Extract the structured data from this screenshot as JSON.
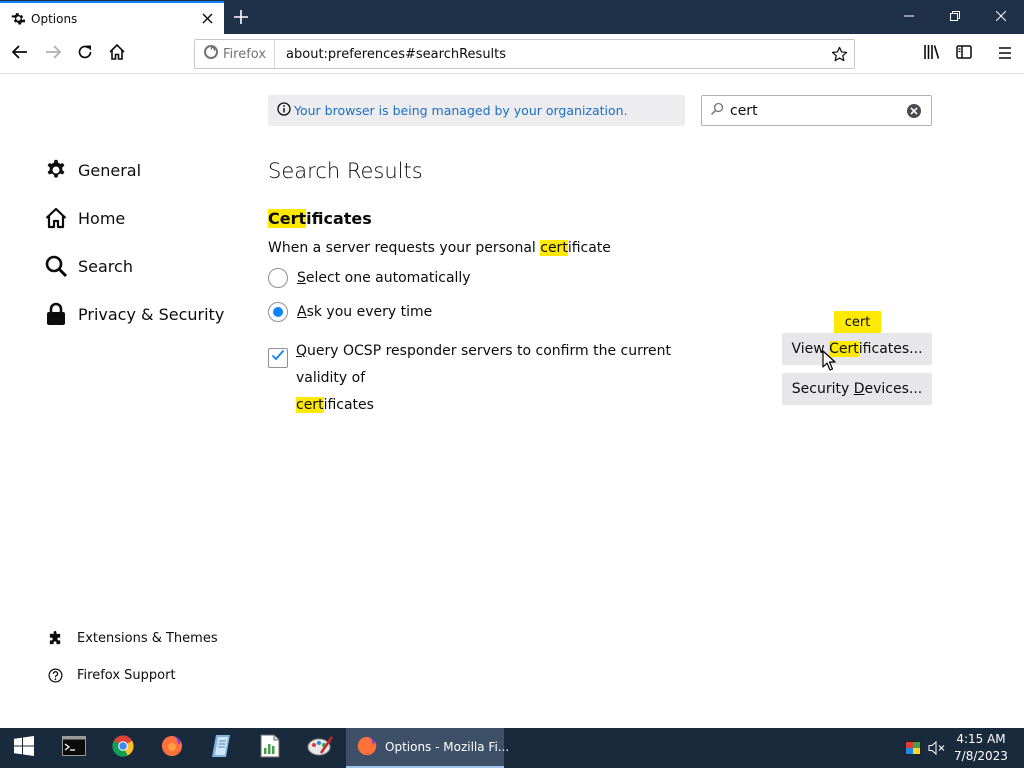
{
  "tab": {
    "title": "Options"
  },
  "nav": {
    "identity_label": "Firefox",
    "url": "about:preferences#searchResults"
  },
  "managed_notice": "Your browser is being managed by your organization.",
  "search": {
    "value": "cert"
  },
  "sidebar": {
    "categories": [
      {
        "label": "General",
        "icon": "gear-icon"
      },
      {
        "label": "Home",
        "icon": "home-icon"
      },
      {
        "label": "Search",
        "icon": "search-icon"
      },
      {
        "label": "Privacy & Security",
        "icon": "lock-icon"
      }
    ],
    "footer": [
      {
        "label": "Extensions & Themes",
        "icon": "puzzle-icon"
      },
      {
        "label": "Firefox Support",
        "icon": "help-icon"
      }
    ]
  },
  "main": {
    "page_title": "Search Results",
    "section": {
      "title_hl": "Cert",
      "title_rest": "ificates",
      "desc_pre": "When a server requests your personal ",
      "desc_hl": "cert",
      "desc_post": "ificate",
      "radio_auto": {
        "accesskey": "S",
        "rest": "elect one automatically",
        "checked": false
      },
      "radio_ask": {
        "accesskey": "A",
        "rest": "sk you every time",
        "checked": true
      },
      "ocsp": {
        "accesskey": "Q",
        "line1_rest": "uery OCSP responder servers to confirm the current validity of",
        "line2_hl": "cert",
        "line2_rest": "ificates",
        "checked": true
      },
      "view_btn": {
        "pre": "View ",
        "hl": "Cert",
        "post": "ificates..."
      },
      "devices_btn": {
        "pre": "Security ",
        "accesskey": "D",
        "post": "evices..."
      },
      "tooltip": "cert"
    }
  },
  "taskbar": {
    "active_window": "Options - Mozilla Fi...",
    "time": "4:15 AM",
    "date": "7/8/2023"
  }
}
